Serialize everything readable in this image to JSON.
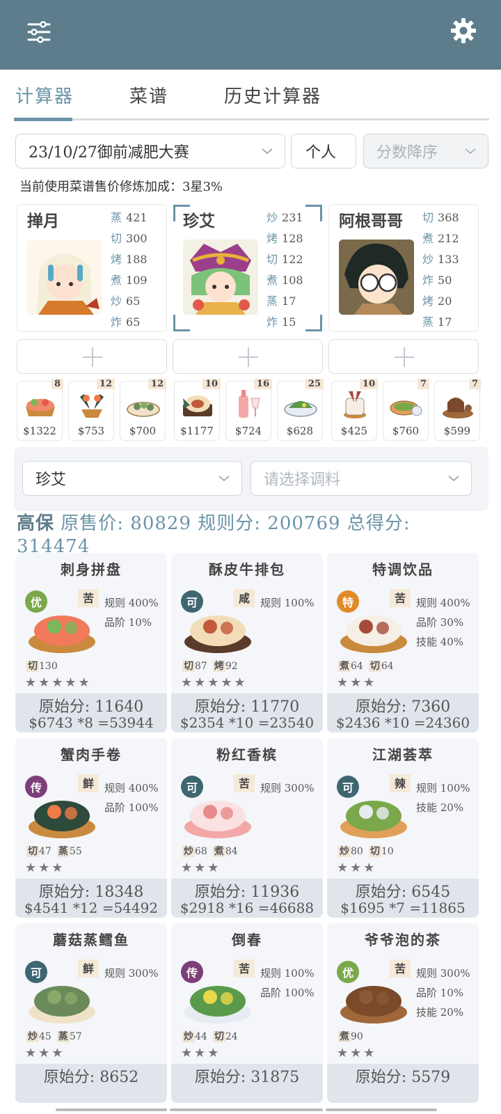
{
  "tabs": [
    "计算器",
    "菜谱",
    "历史计算器"
  ],
  "filters": {
    "contest": "23/10/27御前减肥大赛",
    "mode": "个人",
    "sort": "分数降序"
  },
  "note": "当前使用菜谱售价修炼加成：3星3%",
  "chefs": [
    {
      "name": "掸月",
      "skills": [
        [
          "蒸",
          "421"
        ],
        [
          "切",
          "300"
        ],
        [
          "烤",
          "188"
        ],
        [
          "煮",
          "109"
        ],
        [
          "炒",
          "65"
        ],
        [
          "炸",
          "65"
        ]
      ]
    },
    {
      "name": "珍艾",
      "skills": [
        [
          "炒",
          "231"
        ],
        [
          "烤",
          "128"
        ],
        [
          "切",
          "122"
        ],
        [
          "煮",
          "108"
        ],
        [
          "蒸",
          "17"
        ],
        [
          "炸",
          "15"
        ]
      ]
    },
    {
      "name": "阿根哥哥",
      "skills": [
        [
          "切",
          "368"
        ],
        [
          "煮",
          "212"
        ],
        [
          "炒",
          "133"
        ],
        [
          "炸",
          "50"
        ],
        [
          "烤",
          "20"
        ],
        [
          "蒸",
          "17"
        ]
      ]
    }
  ],
  "dish_strip": [
    {
      "count": "8",
      "price": "$1322"
    },
    {
      "count": "12",
      "price": "$753"
    },
    {
      "count": "12",
      "price": "$700"
    },
    {
      "count": "10",
      "price": "$1177"
    },
    {
      "count": "16",
      "price": "$724"
    },
    {
      "count": "25",
      "price": "$628"
    },
    {
      "count": "10",
      "price": "$425"
    },
    {
      "count": "7",
      "price": "$760"
    },
    {
      "count": "7",
      "price": "$599"
    }
  ],
  "panel": {
    "chef_select": "珍艾",
    "seasoning_placeholder": "请选择调料"
  },
  "summary": {
    "grade": "高保",
    "text": "原售价: 80829 规则分: 200769 总得分: 314474"
  },
  "recipes": [
    {
      "name": "刺身拼盘",
      "badge": "优",
      "taste": "苦",
      "rules": [
        "规则 400%",
        "品阶 10%"
      ],
      "skills": [
        [
          "切",
          "130"
        ]
      ],
      "stars": "★★★★★",
      "raw": "原始分: 11640",
      "calc": "$6743 *8 =53944"
    },
    {
      "name": "酥皮牛排包",
      "badge": "可",
      "taste": "咸",
      "rules": [
        "规则 100%"
      ],
      "skills": [
        [
          "切",
          "87"
        ],
        [
          "烤",
          "92"
        ]
      ],
      "stars": "★★★★★",
      "raw": "原始分: 11770",
      "calc": "$2354 *10 =23540"
    },
    {
      "name": "特调饮品",
      "badge": "特",
      "taste": "苦",
      "rules": [
        "规则 400%",
        "品阶 30%",
        "技能 40%"
      ],
      "skills": [
        [
          "煮",
          "64"
        ],
        [
          "切",
          "64"
        ]
      ],
      "stars": "★★★",
      "raw": "原始分: 7360",
      "calc": "$2436 *10 =24360"
    },
    {
      "name": "蟹肉手卷",
      "badge": "传",
      "taste": "鲜",
      "rules": [
        "规则 400%",
        "品阶 100%"
      ],
      "skills": [
        [
          "切",
          "47"
        ],
        [
          "蒸",
          "55"
        ]
      ],
      "stars": "★★★",
      "raw": "原始分: 18348",
      "calc": "$4541 *12 =54492"
    },
    {
      "name": "粉红香槟",
      "badge": "可",
      "taste": "苦",
      "rules": [
        "规则 300%"
      ],
      "skills": [
        [
          "炒",
          "68"
        ],
        [
          "煮",
          "84"
        ]
      ],
      "stars": "★★★",
      "raw": "原始分: 11936",
      "calc": "$2918 *16 =46688"
    },
    {
      "name": "江湖荟萃",
      "badge": "可",
      "taste": "辣",
      "rules": [
        "规则 100%",
        "技能 20%"
      ],
      "skills": [
        [
          "炒",
          "80"
        ],
        [
          "切",
          "10"
        ]
      ],
      "stars": "★★★",
      "raw": "原始分: 6545",
      "calc": "$1695 *7 =11865"
    },
    {
      "name": "蘑菇蒸鳕鱼",
      "badge": "可",
      "taste": "鲜",
      "rules": [
        "规则 300%"
      ],
      "skills": [
        [
          "炒",
          "45"
        ],
        [
          "蒸",
          "57"
        ]
      ],
      "stars": "★★★",
      "raw": "原始分: 8652",
      "calc": ""
    },
    {
      "name": "倒春",
      "badge": "传",
      "taste": "苦",
      "rules": [
        "规则 100%",
        "品阶 100%"
      ],
      "skills": [
        [
          "炒",
          "44"
        ],
        [
          "切",
          "24"
        ]
      ],
      "stars": "★★★",
      "raw": "原始分: 31875",
      "calc": ""
    },
    {
      "name": "爷爷泡的茶",
      "badge": "优",
      "taste": "苦",
      "rules": [
        "规则 300%",
        "品阶 10%",
        "技能 20%"
      ],
      "skills": [
        [
          "煮",
          "90"
        ]
      ],
      "stars": "★★★",
      "raw": "原始分: 5579",
      "calc": ""
    }
  ],
  "colors": {
    "header": "#5e7d8c",
    "accent": "#6a93a8",
    "badge_you": "#7aa84a",
    "badge_ke": "#3e6670",
    "badge_te": "#e08a2a",
    "badge_chuan": "#7d3f7a"
  }
}
